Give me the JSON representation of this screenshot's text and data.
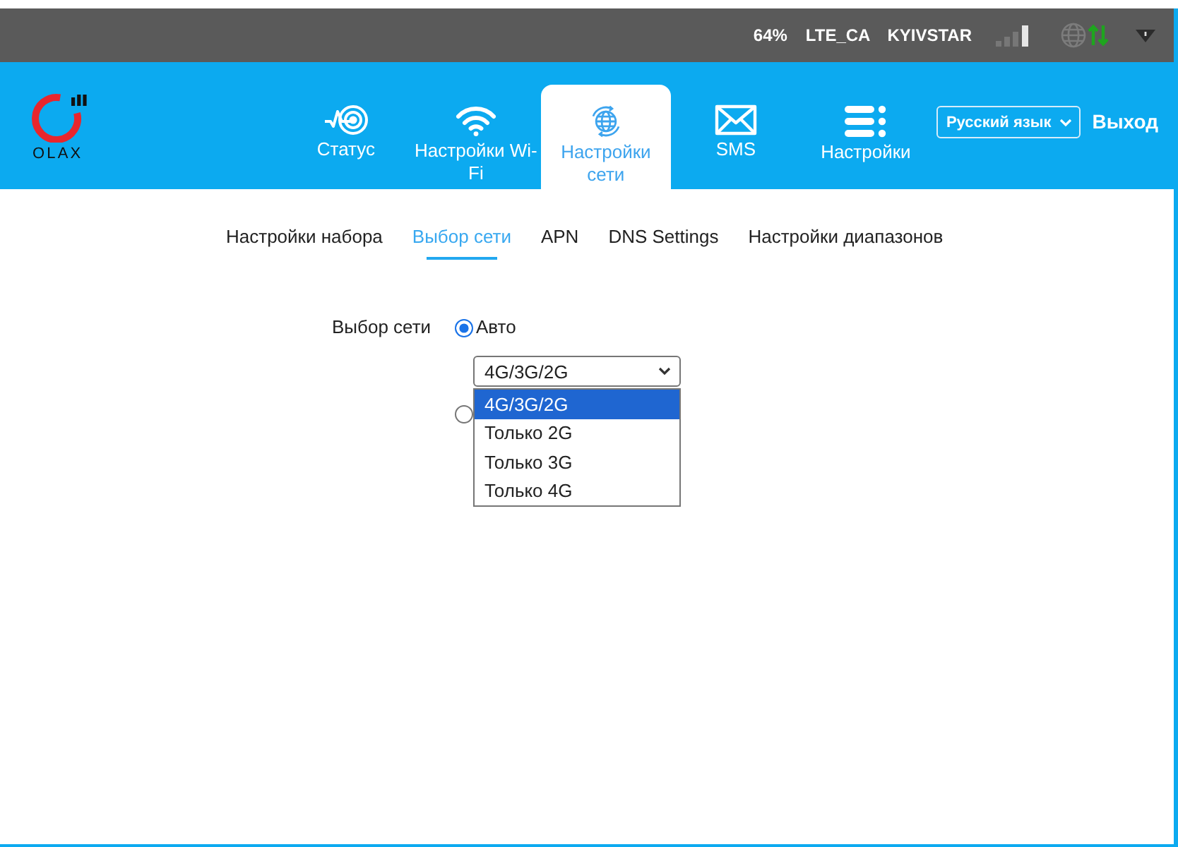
{
  "status_bar": {
    "battery": "64%",
    "network_type": "LTE_CA",
    "operator": "KYIVSTAR"
  },
  "header": {
    "logo_text": "OLAX",
    "nav_tabs": [
      {
        "label": "Статус",
        "selected": false
      },
      {
        "label": "Настройки Wi-Fi",
        "selected": false
      },
      {
        "label": "Настройки сети",
        "selected": true
      },
      {
        "label": "SMS",
        "selected": false
      },
      {
        "label": "Настройки",
        "selected": false
      }
    ],
    "language_select": {
      "value": "Русский язык"
    },
    "logout": "Выход"
  },
  "sub_tabs": [
    {
      "label": "Настройки набора",
      "selected": false
    },
    {
      "label": "Выбор сети",
      "selected": true
    },
    {
      "label": "APN",
      "selected": false
    },
    {
      "label": "DNS Settings",
      "selected": false
    },
    {
      "label": "Настройки диапазонов",
      "selected": false
    }
  ],
  "network_selection": {
    "label": "Выбор сети",
    "radios": [
      {
        "label": "Авто",
        "selected": true
      },
      {
        "selected": false
      }
    ],
    "mode_select": {
      "value": "4G/3G/2G",
      "expanded": true,
      "options": [
        {
          "label": "4G/3G/2G",
          "selected": true
        },
        {
          "label": "Только 2G",
          "selected": false
        },
        {
          "label": "Только 3G",
          "selected": false
        },
        {
          "label": "Только 4G",
          "selected": false
        }
      ]
    }
  }
}
